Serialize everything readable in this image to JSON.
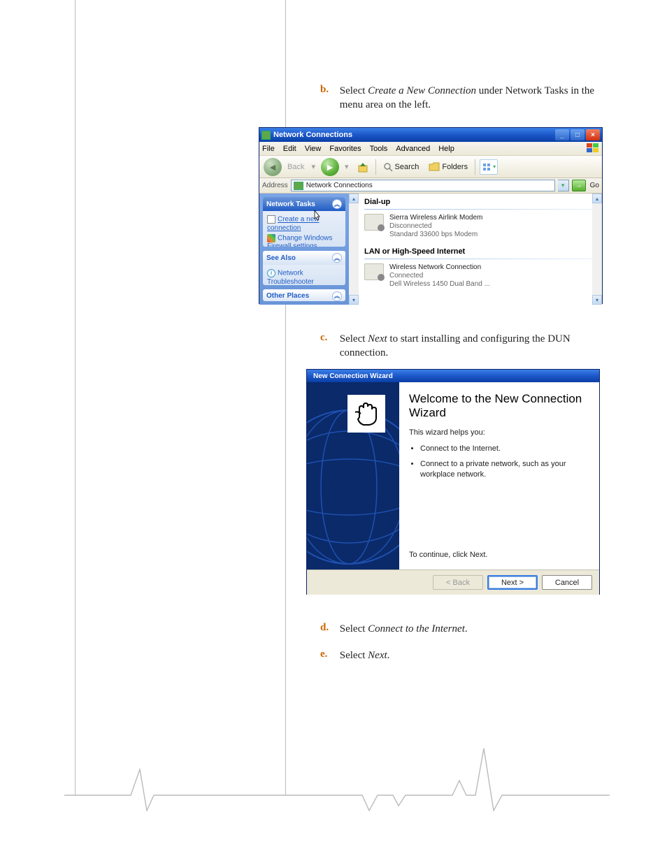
{
  "step_b": {
    "letter": "b.",
    "prefix": "Select ",
    "italic": "Create a New Connection",
    "suffix": " under Network Tasks in the menu area on the left."
  },
  "step_c": {
    "letter": "c.",
    "prefix": "Select ",
    "italic": "Next",
    "suffix": " to start installing and configuring the DUN connection."
  },
  "step_d": {
    "letter": "d.",
    "prefix": "Select ",
    "italic": "Connect to the Internet",
    "suffix": "."
  },
  "step_e": {
    "letter": "e.",
    "prefix": "Select ",
    "italic": "Next",
    "suffix": "."
  },
  "nc_window": {
    "title": "Network Connections",
    "menu": [
      "File",
      "Edit",
      "View",
      "Favorites",
      "Tools",
      "Advanced",
      "Help"
    ],
    "toolbar": {
      "back": "Back",
      "search": "Search",
      "folders": "Folders"
    },
    "address": {
      "label": "Address",
      "value": "Network Connections",
      "go": "Go"
    },
    "panels": {
      "tasks": {
        "title": "Network Tasks",
        "link1": "Create a new connection",
        "link2": "Change Windows Firewall settings"
      },
      "seealso": {
        "title": "See Also",
        "link1": "Network Troubleshooter"
      },
      "other": {
        "title": "Other Places"
      }
    },
    "sections": {
      "dialup": {
        "header": "Dial-up",
        "item": {
          "name": "Sierra Wireless Airlink Modem",
          "status": "Disconnected",
          "device": "Standard 33600 bps Modem"
        }
      },
      "lan": {
        "header": "LAN or High-Speed Internet",
        "item": {
          "name": "Wireless Network Connection",
          "status": "Connected",
          "device": "Dell Wireless 1450 Dual Band ..."
        }
      }
    }
  },
  "wizard": {
    "title": "New Connection Wizard",
    "heading": "Welcome to the New Connection Wizard",
    "intro": "This wizard helps you:",
    "bullets": [
      "Connect to the Internet.",
      "Connect to a private network, such as your workplace network."
    ],
    "continue": "To continue, click Next.",
    "buttons": {
      "back": "< Back",
      "next": "Next >",
      "cancel": "Cancel"
    }
  }
}
